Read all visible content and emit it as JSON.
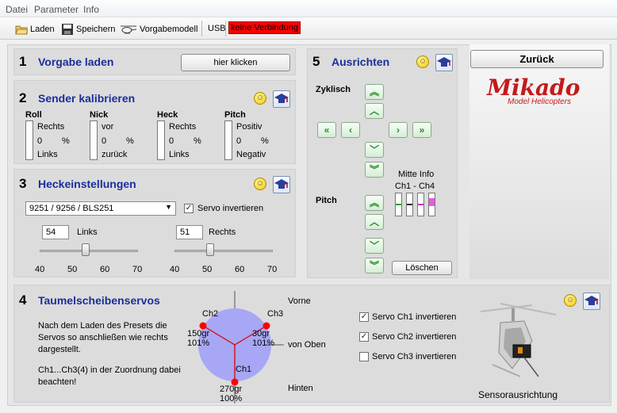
{
  "menu": [
    "Datei",
    "Parameter",
    "Info"
  ],
  "toolbar": {
    "load": "Laden",
    "save": "Speichern",
    "model": "Vorgabemodell",
    "usb": "USB",
    "connection": "keine Verbindung"
  },
  "sections": {
    "s1": {
      "num": "1",
      "title": "Vorgabe laden",
      "button": "hier klicken"
    },
    "s2": {
      "num": "2",
      "title": "Sender kalibrieren",
      "channels": [
        {
          "name": "Roll",
          "top": "Rechts",
          "value": "0",
          "unit": "%",
          "bottom": "Links"
        },
        {
          "name": "Nick",
          "top": "vor",
          "value": "0",
          "unit": "%",
          "bottom": "zurück"
        },
        {
          "name": "Heck",
          "top": "Rechts",
          "value": "0",
          "unit": "%",
          "bottom": "Links"
        },
        {
          "name": "Pitch",
          "top": "Positiv",
          "value": "0",
          "unit": "%",
          "bottom": "Negativ"
        }
      ]
    },
    "s3": {
      "num": "3",
      "title": "Heckeinstellungen",
      "servo_select": "9251 / 9256 / BLS251",
      "servo_invert": "Servo invertieren",
      "left_value": "54",
      "left_label": "Links",
      "right_value": "51",
      "right_label": "Rechts",
      "ticks": [
        "40",
        "50",
        "60",
        "70"
      ],
      "left_level_pct": 54,
      "right_level_pct": 51
    },
    "s4": {
      "num": "4",
      "title": "Taumelscheibenservos",
      "text1": "Nach dem Laden des Presets die Servos so anschließen wie rechts dargestellt.",
      "text2": "Ch1...Ch3(4) in der Zuordnung dabei beachten!",
      "vorne": "Vorne",
      "hinten": "Hinten",
      "von_oben": "von Oben",
      "ch1": "Ch1",
      "ch2": "Ch2",
      "ch3": "Ch3",
      "ch2_deg": "150gr",
      "ch2_pct": "101%",
      "ch3_deg": "30gr",
      "ch3_pct": "101%",
      "ch1_deg": "270gr",
      "ch1_pct": "100%",
      "inv1": "Servo Ch1 invertieren",
      "inv2": "Servo Ch2 invertieren",
      "inv3": "Servo Ch3 invertieren",
      "sensor": "Sensorausrichtung"
    },
    "s5": {
      "num": "5",
      "title": "Ausrichten",
      "zyklisch": "Zyklisch",
      "pitch": "Pitch",
      "mitte_info": "Mitte Info",
      "ch_range": "Ch1 - Ch4",
      "clear": "Löschen"
    }
  },
  "back": "Zurück",
  "logo": {
    "brand": "Mikado",
    "sub": "Model Helicopters"
  },
  "colors": {
    "title": "#1a2f9a",
    "arrow": "#2a8a2a",
    "logo": "#c41a1a",
    "error": "#ff0000"
  }
}
